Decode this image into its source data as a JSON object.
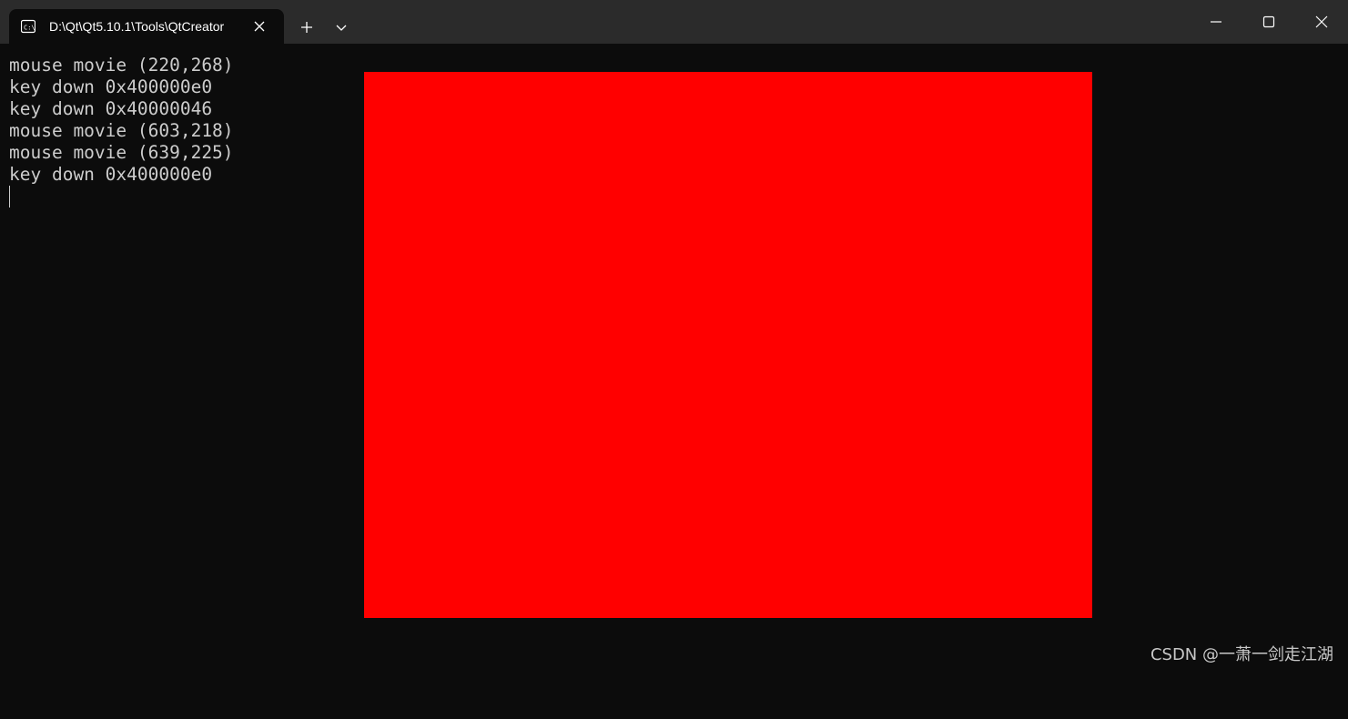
{
  "window": {
    "tab_title": "D:\\Qt\\Qt5.10.1\\Tools\\QtCreator"
  },
  "icons": {
    "tab_icon": "terminal-icon",
    "tab_close": "close-icon",
    "new_tab": "plus-icon",
    "dropdown": "chevron-down-icon",
    "minimize": "minimize-icon",
    "maximize": "maximize-icon",
    "close": "close-icon"
  },
  "console": {
    "lines": [
      "mouse movie (220,268)",
      "key down 0x400000e0",
      "key down 0x40000046",
      "mouse movie (603,218)",
      "mouse movie (639,225)",
      "key down 0x400000e0"
    ]
  },
  "colors": {
    "terminal_bg": "#0c0c0c",
    "titlebar_bg": "#2b2b2b",
    "text": "#cccccc",
    "render_fill": "#ff0000"
  },
  "watermark": "CSDN @一萧一剑走江湖"
}
